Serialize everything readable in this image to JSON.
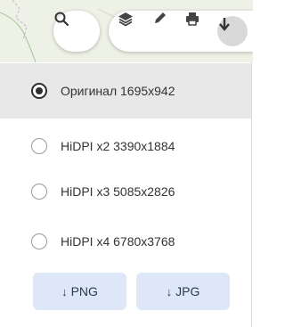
{
  "toolbar": {
    "search_icon": "search-icon",
    "tools": [
      "layers-icon",
      "pencil-icon",
      "print-icon",
      "download-icon"
    ]
  },
  "options": [
    {
      "label": "Оригинал 1695x942",
      "selected": true
    },
    {
      "label": "HiDPI x2 3390x1884",
      "selected": false
    },
    {
      "label": "HiDPI x3 5085x2826",
      "selected": false
    },
    {
      "label": "HiDPI x4 6780x3768",
      "selected": false
    }
  ],
  "buttons": {
    "png": {
      "arrow": "↓",
      "label": "PNG"
    },
    "jpg": {
      "arrow": "↓",
      "label": "JPG"
    }
  },
  "colors": {
    "selected_row": "#e8e8e8",
    "button_bg": "#dde7f7",
    "map_bg": "#eef1e6"
  }
}
